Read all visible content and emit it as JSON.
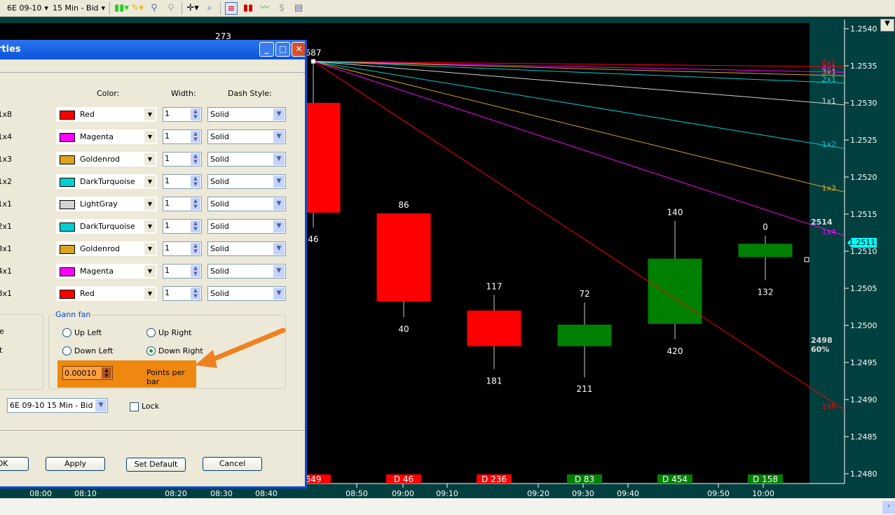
{
  "toolbar": {
    "instrument": "6E 09-10",
    "interval": "15 Min - Bid",
    "icons": [
      "candlestick-style-icon",
      "pencil-draw-icon",
      "zoom-in-icon",
      "zoom-out-icon",
      "crosshair-icon",
      "magnifier-icon",
      "chart-trader-icon",
      "bar-chart-icon",
      "line-chart-icon",
      "dollar-icon",
      "properties-icon"
    ]
  },
  "chart": {
    "colors": {
      "background": "#000000",
      "frame": "#023f3f",
      "up": "#008000",
      "down": "#ff0000"
    },
    "price_axis": [
      "1.2540",
      "1.2535",
      "1.2530",
      "1.2525",
      "1.2520",
      "1.2515",
      "1.2510",
      "1.2505",
      "1.2500",
      "1.2495",
      "1.2490",
      "1.2485",
      "1.2480"
    ],
    "current_price": "1.2511",
    "time_axis": [
      "08:00",
      "08:10",
      "08:20",
      "08:30",
      "08:40",
      "08:50",
      "09:00",
      "09:10",
      "09:20",
      "09:30",
      "09:40",
      "09:50",
      "10:00"
    ],
    "candles": [
      {
        "open": 1.253,
        "high": 1.25356,
        "low": 1.25132,
        "close": 1.25152,
        "top_label": "687",
        "bottom_label": "46",
        "volume_label": "649",
        "dir": "down"
      },
      {
        "open": 1.25151,
        "high": 1.25151,
        "low": 1.25011,
        "close": 1.25032,
        "top_label": "86",
        "bottom_label": "40",
        "volume_label": "D 46",
        "dir": "down"
      },
      {
        "open": 1.2502,
        "high": 1.25041,
        "low": 1.24941,
        "close": 1.24972,
        "top_label": "117",
        "bottom_label": "181",
        "volume_label": "D 236",
        "dir": "down"
      },
      {
        "open": 1.24972,
        "high": 1.25031,
        "low": 1.2493,
        "close": 1.25001,
        "top_label": "72",
        "bottom_label": "211",
        "volume_label": "D 83",
        "dir": "up"
      },
      {
        "open": 1.25002,
        "high": 1.25141,
        "low": 1.24981,
        "close": 1.2509,
        "top_label": "140",
        "bottom_label": "420",
        "volume_label": "D 454",
        "dir": "up"
      },
      {
        "open": 1.25092,
        "high": 1.25121,
        "low": 1.25061,
        "close": 1.2511,
        "top_label": "0",
        "bottom_label": "132",
        "volume_label": "D 158",
        "dir": "up"
      }
    ],
    "extra_labels": {
      "top_left": "273",
      "right_a": "2514",
      "right_b": "2498",
      "right_c": "60%"
    },
    "gann_fan": {
      "anchor_price": 1.25356,
      "points_per_bar": 0.0001,
      "direction": "Down Right",
      "lines": [
        {
          "label": "8x1",
          "ratio": 0.125,
          "color": "#ff0000"
        },
        {
          "label": "4x1",
          "ratio": 0.25,
          "color": "#ff00ff"
        },
        {
          "label": "3x1",
          "ratio": 0.3333,
          "color": "#daa520"
        },
        {
          "label": "2x1",
          "ratio": 0.5,
          "color": "#00ced1"
        },
        {
          "label": "1x1",
          "ratio": 1,
          "color": "#d3d3d3"
        },
        {
          "label": "1x2",
          "ratio": 2,
          "color": "#00ced1"
        },
        {
          "label": "1x3",
          "ratio": 3,
          "color": "#daa520"
        },
        {
          "label": "1x4",
          "ratio": 4,
          "color": "#ff00ff"
        },
        {
          "label": "1x8",
          "ratio": 8,
          "color": "#ff0000"
        }
      ]
    }
  },
  "dialog": {
    "title": "Properties",
    "headers": {
      "color": "Color:",
      "width": "Width:",
      "dash": "Dash Style:"
    },
    "rows": [
      {
        "label": "1x8",
        "color": "Red",
        "swatch": "#ff0000",
        "width": "1",
        "dash": "Solid"
      },
      {
        "label": "1x4",
        "color": "Magenta",
        "swatch": "#ff00ff",
        "width": "1",
        "dash": "Solid"
      },
      {
        "label": "1x3",
        "color": "Goldenrod",
        "swatch": "#daa520",
        "width": "1",
        "dash": "Solid"
      },
      {
        "label": "1x2",
        "color": "DarkTurquoise",
        "swatch": "#00ced1",
        "width": "1",
        "dash": "Solid"
      },
      {
        "label": "1x1",
        "color": "LightGray",
        "swatch": "#d3d3d3",
        "width": "1",
        "dash": "Solid"
      },
      {
        "label": "2x1",
        "color": "DarkTurquoise",
        "swatch": "#00ced1",
        "width": "1",
        "dash": "Solid"
      },
      {
        "label": "3x1",
        "color": "Goldenrod",
        "swatch": "#daa520",
        "width": "1",
        "dash": "Solid"
      },
      {
        "label": "4x1",
        "color": "Magenta",
        "swatch": "#ff00ff",
        "width": "1",
        "dash": "Solid"
      },
      {
        "label": "8x1",
        "color": "Red",
        "swatch": "#ff0000",
        "width": "1",
        "dash": "Solid"
      }
    ],
    "left_group_labels": [
      "e",
      "t"
    ],
    "gann_group": {
      "title": "Gann fan",
      "options": [
        "Up Left",
        "Up Right",
        "Down Left",
        "Down Right"
      ],
      "selected": "Down Right",
      "points_value": "0.00010",
      "points_label": "Points per bar",
      "highlight_color": "#ee8810"
    },
    "series_select": "6E 09-10 15 Min - Bid",
    "lock_label": "Lock",
    "lock_checked": false,
    "buttons": {
      "ok": "OK",
      "apply": "Apply",
      "set_default": "Set Default",
      "cancel": "Cancel"
    }
  }
}
